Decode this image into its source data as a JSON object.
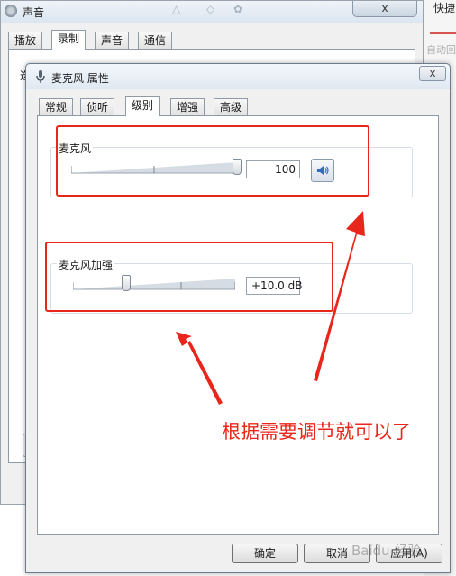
{
  "bg_window": {
    "title": "声音",
    "close_label": "x",
    "toolbar_icons": [
      "blurred-icon-1",
      "blurred-icon-2",
      "blurred-icon-3"
    ],
    "tabs": [
      "播放",
      "录制",
      "声音",
      "通信"
    ],
    "active_tab": "录制",
    "list_first_char": "选"
  },
  "right_strip": {
    "label1": "快捷",
    "label2": "自动回"
  },
  "dialog": {
    "title": "麦克风 属性",
    "close_label": "x",
    "tabs": [
      "常规",
      "侦听",
      "级别",
      "增强",
      "高级"
    ],
    "active_tab": "级别",
    "mic": {
      "label": "麦克风",
      "value": "100",
      "level": 1.0
    },
    "boost": {
      "label": "麦克风加强",
      "value": "+10.0 dB",
      "level": 0.33
    },
    "buttons": {
      "ok": "确定",
      "cancel": "取消",
      "apply": "应用(A)"
    }
  },
  "annotation": {
    "text": "根据需要调节就可以了",
    "color": "#e8261c"
  },
  "watermark": {
    "text": "Baidu 经验"
  }
}
